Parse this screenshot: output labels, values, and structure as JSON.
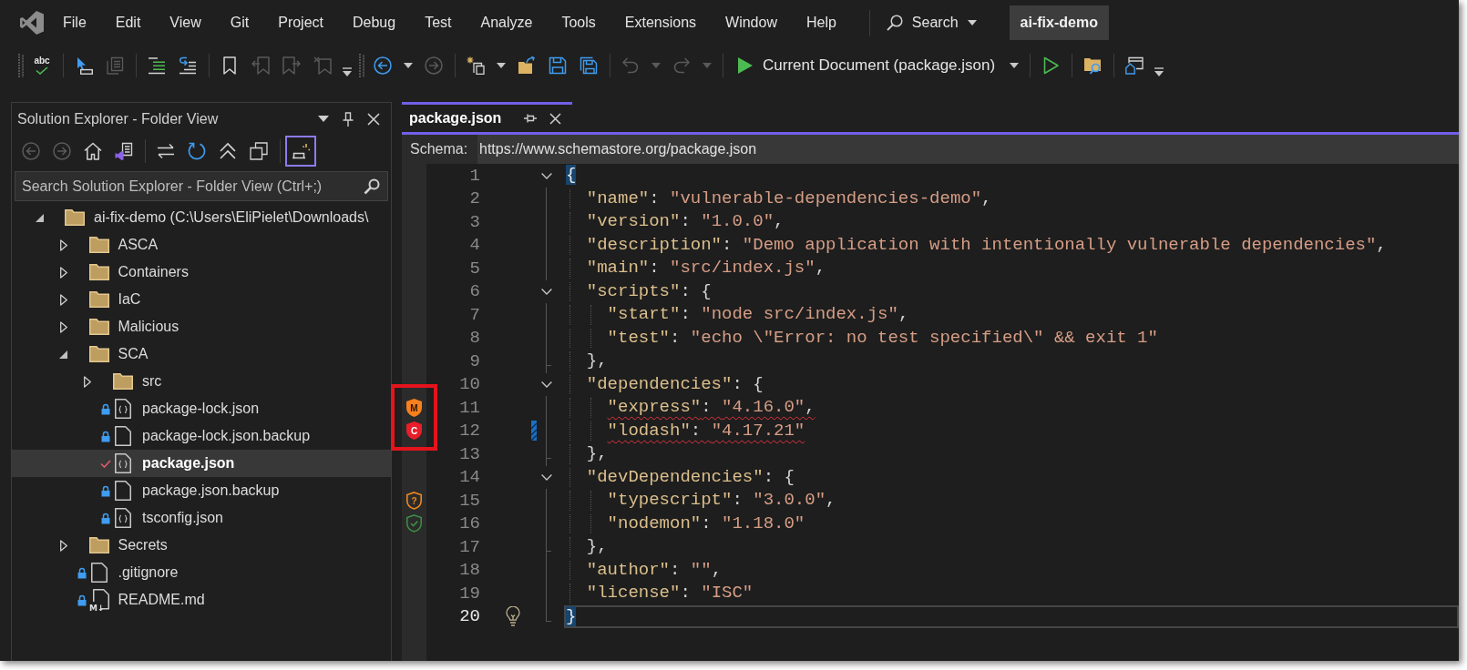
{
  "menu": {
    "items": [
      "File",
      "Edit",
      "View",
      "Git",
      "Project",
      "Debug",
      "Test",
      "Analyze",
      "Tools",
      "Extensions",
      "Window",
      "Help"
    ],
    "search": "Search",
    "solution": "ai-fix-demo"
  },
  "toolbar": {
    "buttons": [
      {
        "kind": "grip"
      },
      {
        "kind": "spell",
        "label": "abc",
        "disabled": false
      },
      {
        "kind": "separator"
      },
      {
        "kind": "select",
        "disabled": false
      },
      {
        "kind": "copy-lines",
        "disabled": true
      },
      {
        "kind": "separator"
      },
      {
        "kind": "comment",
        "disabled": false
      },
      {
        "kind": "uncomment",
        "disabled": false
      },
      {
        "kind": "separator"
      },
      {
        "kind": "bookmark",
        "disabled": false
      },
      {
        "kind": "bookmark-prev",
        "disabled": true
      },
      {
        "kind": "bookmark-next",
        "disabled": true
      },
      {
        "kind": "bookmark-clear",
        "disabled": true
      },
      {
        "kind": "overflow"
      },
      {
        "kind": "grip"
      },
      {
        "kind": "back",
        "disabled": false
      },
      {
        "kind": "caret",
        "disabled": false
      },
      {
        "kind": "forward",
        "disabled": true
      },
      {
        "kind": "separator"
      },
      {
        "kind": "new-item",
        "disabled": false
      },
      {
        "kind": "caret",
        "disabled": false
      },
      {
        "kind": "open",
        "disabled": false
      },
      {
        "kind": "save",
        "disabled": false
      },
      {
        "kind": "save-all",
        "disabled": false
      },
      {
        "kind": "separator"
      },
      {
        "kind": "undo",
        "disabled": true
      },
      {
        "kind": "caret",
        "disabled": true
      },
      {
        "kind": "redo",
        "disabled": true
      },
      {
        "kind": "caret",
        "disabled": true
      },
      {
        "kind": "separator"
      },
      {
        "kind": "run",
        "label": "Current Document (package.json)",
        "disabled": false
      },
      {
        "kind": "caret",
        "disabled": false
      },
      {
        "kind": "separator"
      },
      {
        "kind": "run-outline",
        "disabled": false
      },
      {
        "kind": "separator"
      },
      {
        "kind": "find-folder",
        "disabled": false
      },
      {
        "kind": "separator"
      },
      {
        "kind": "window",
        "disabled": false
      },
      {
        "kind": "overflow"
      }
    ]
  },
  "solution_explorer": {
    "title": "Solution Explorer - Folder View",
    "buttons": [
      {
        "kind": "back",
        "disabled": true,
        "pressed": false
      },
      {
        "kind": "forward",
        "disabled": true,
        "pressed": false
      },
      {
        "kind": "home",
        "disabled": false,
        "pressed": false
      },
      {
        "kind": "switch-views",
        "disabled": false,
        "pressed": false
      },
      {
        "kind": "separator"
      },
      {
        "kind": "sync",
        "disabled": false,
        "pressed": false
      },
      {
        "kind": "refresh",
        "disabled": false,
        "pressed": false
      },
      {
        "kind": "collapse",
        "disabled": false,
        "pressed": false
      },
      {
        "kind": "show-all",
        "disabled": false,
        "pressed": false
      },
      {
        "kind": "separator"
      },
      {
        "kind": "pending",
        "disabled": false,
        "pressed": true
      }
    ],
    "search": {
      "placeholder": "Search Solution Explorer - Folder View (Ctrl+;)"
    },
    "tree": [
      {
        "label": "ai-fix-demo (C:\\Users\\EliPielet\\Downloads\\",
        "kind": "folder",
        "expanded": true,
        "selected": false,
        "children": [
          {
            "label": "ASCA",
            "kind": "folder",
            "expanded": false,
            "selected": false
          },
          {
            "label": "Containers",
            "kind": "folder",
            "expanded": false,
            "selected": false
          },
          {
            "label": "IaC",
            "kind": "folder",
            "expanded": false,
            "selected": false
          },
          {
            "label": "Malicious",
            "kind": "folder",
            "expanded": false,
            "selected": false
          },
          {
            "label": "SCA",
            "kind": "folder",
            "expanded": true,
            "selected": false,
            "children": [
              {
                "label": "src",
                "kind": "folder",
                "expanded": false,
                "selected": false
              },
              {
                "label": "package-lock.json",
                "kind": "json",
                "locked": true,
                "modified": false,
                "selected": false
              },
              {
                "label": "package-lock.json.backup",
                "kind": "file",
                "locked": true,
                "modified": false,
                "selected": false
              },
              {
                "label": "package.json",
                "kind": "json",
                "locked": false,
                "modified": true,
                "selected": true
              },
              {
                "label": "package.json.backup",
                "kind": "file",
                "locked": true,
                "modified": false,
                "selected": false
              },
              {
                "label": "tsconfig.json",
                "kind": "json",
                "locked": true,
                "modified": false,
                "selected": false
              }
            ]
          },
          {
            "label": "Secrets",
            "kind": "folder",
            "expanded": false,
            "selected": false
          },
          {
            "label": ".gitignore",
            "kind": "file",
            "locked": true,
            "modified": false,
            "selected": false
          },
          {
            "label": "README.md",
            "kind": "markdown",
            "icon_text": "M↓",
            "locked": true,
            "modified": false,
            "selected": false
          }
        ]
      }
    ]
  },
  "editor": {
    "tabs": [
      {
        "label": "package.json",
        "selected": true
      }
    ],
    "schema": {
      "label": "Schema:",
      "value": "https://www.schemastore.org/package.json"
    },
    "lines": [
      {
        "number": "1",
        "tokens": [
          {
            "kind": "brace-match",
            "text": "{"
          }
        ],
        "current": false,
        "squiggle": false,
        "expanded": true,
        "children": [
          {
            "number": "2",
            "tokens": [
              {
                "kind": "key",
                "text": "\"name\""
              },
              {
                "kind": "punct",
                "text": ": "
              },
              {
                "kind": "string",
                "text": "\"vulnerable-dependencies-demo\""
              },
              {
                "kind": "punct",
                "text": ","
              }
            ],
            "current": false,
            "squiggle": false
          },
          {
            "number": "3",
            "tokens": [
              {
                "kind": "key",
                "text": "\"version\""
              },
              {
                "kind": "punct",
                "text": ": "
              },
              {
                "kind": "string",
                "text": "\"1.0.0\""
              },
              {
                "kind": "punct",
                "text": ","
              }
            ],
            "current": false,
            "squiggle": false
          },
          {
            "number": "4",
            "tokens": [
              {
                "kind": "key",
                "text": "\"description\""
              },
              {
                "kind": "punct",
                "text": ": "
              },
              {
                "kind": "string",
                "text": "\"Demo application with intentionally vulnerable dependencies\""
              },
              {
                "kind": "punct",
                "text": ","
              }
            ],
            "current": false,
            "squiggle": false
          },
          {
            "number": "5",
            "tokens": [
              {
                "kind": "key",
                "text": "\"main\""
              },
              {
                "kind": "punct",
                "text": ": "
              },
              {
                "kind": "string",
                "text": "\"src/index.js\""
              },
              {
                "kind": "punct",
                "text": ","
              }
            ],
            "current": false,
            "squiggle": false
          },
          {
            "number": "6",
            "tokens": [
              {
                "kind": "key",
                "text": "\"scripts\""
              },
              {
                "kind": "punct",
                "text": ": {"
              }
            ],
            "current": false,
            "squiggle": false,
            "expanded": true,
            "children": [
              {
                "number": "7",
                "tokens": [
                  {
                    "kind": "key",
                    "text": "\"start\""
                  },
                  {
                    "kind": "punct",
                    "text": ": "
                  },
                  {
                    "kind": "string",
                    "text": "\"node src/index.js\""
                  },
                  {
                    "kind": "punct",
                    "text": ","
                  }
                ],
                "current": false,
                "squiggle": false
              },
              {
                "number": "8",
                "tokens": [
                  {
                    "kind": "key",
                    "text": "\"test\""
                  },
                  {
                    "kind": "punct",
                    "text": ": "
                  },
                  {
                    "kind": "string",
                    "text": "\"echo \\\"Error: no test specified\\\" && exit 1\""
                  }
                ],
                "current": false,
                "squiggle": false
              }
            ]
          },
          {
            "number": "9",
            "tokens": [
              {
                "kind": "punct",
                "text": "},"
              }
            ],
            "current": false,
            "squiggle": false
          },
          {
            "number": "10",
            "tokens": [
              {
                "kind": "key",
                "text": "\"dependencies\""
              },
              {
                "kind": "punct",
                "text": ": {"
              }
            ],
            "current": false,
            "squiggle": false,
            "expanded": true,
            "children": [
              {
                "number": "11",
                "tokens": [
                  {
                    "kind": "key",
                    "text": "\"express\""
                  },
                  {
                    "kind": "punct",
                    "text": ": "
                  },
                  {
                    "kind": "string",
                    "text": "\"4.16.0\""
                  },
                  {
                    "kind": "punct",
                    "text": ","
                  }
                ],
                "current": false,
                "squiggle": true,
                "gutter": {
                  "kind": "shield",
                  "label": "M",
                  "color": "#f7801e"
                }
              },
              {
                "number": "12",
                "tokens": [
                  {
                    "kind": "key",
                    "text": "\"lodash\""
                  },
                  {
                    "kind": "punct",
                    "text": ": "
                  },
                  {
                    "kind": "string",
                    "text": "\"4.17.21\""
                  }
                ],
                "current": false,
                "squiggle": true,
                "gutter": {
                  "kind": "shield",
                  "label": "C",
                  "color": "#e81e2a"
                },
                "glyph": {
                  "kind": "change"
                }
              }
            ]
          },
          {
            "number": "13",
            "tokens": [
              {
                "kind": "punct",
                "text": "},"
              }
            ],
            "current": false,
            "squiggle": false
          },
          {
            "number": "14",
            "tokens": [
              {
                "kind": "key",
                "text": "\"devDependencies\""
              },
              {
                "kind": "punct",
                "text": ": {"
              }
            ],
            "current": false,
            "squiggle": false,
            "expanded": true,
            "children": [
              {
                "number": "15",
                "tokens": [
                  {
                    "kind": "key",
                    "text": "\"typescript\""
                  },
                  {
                    "kind": "punct",
                    "text": ": "
                  },
                  {
                    "kind": "string",
                    "text": "\"3.0.0\""
                  },
                  {
                    "kind": "punct",
                    "text": ","
                  }
                ],
                "current": false,
                "squiggle": false,
                "gutter": {
                  "kind": "shield-outline",
                  "label": "?",
                  "color": "#f08a1c"
                }
              },
              {
                "number": "16",
                "tokens": [
                  {
                    "kind": "key",
                    "text": "\"nodemon\""
                  },
                  {
                    "kind": "punct",
                    "text": ": "
                  },
                  {
                    "kind": "string",
                    "text": "\"1.18.0\""
                  }
                ],
                "current": false,
                "squiggle": false,
                "gutter": {
                  "kind": "shield-check",
                  "color": "#3c8c45"
                }
              }
            ]
          },
          {
            "number": "17",
            "tokens": [
              {
                "kind": "punct",
                "text": "},"
              }
            ],
            "current": false,
            "squiggle": false
          },
          {
            "number": "18",
            "tokens": [
              {
                "kind": "key",
                "text": "\"author\""
              },
              {
                "kind": "punct",
                "text": ": "
              },
              {
                "kind": "string",
                "text": "\"\""
              },
              {
                "kind": "punct",
                "text": ","
              }
            ],
            "current": false,
            "squiggle": false
          },
          {
            "number": "19",
            "tokens": [
              {
                "kind": "key",
                "text": "\"license\""
              },
              {
                "kind": "punct",
                "text": ": "
              },
              {
                "kind": "string",
                "text": "\"ISC\""
              }
            ],
            "current": false,
            "squiggle": false
          }
        ]
      },
      {
        "number": "20",
        "tokens": [
          {
            "kind": "brace-match",
            "text": "}"
          }
        ],
        "current": true,
        "squiggle": false,
        "glyph": {
          "kind": "lightbulb"
        }
      }
    ]
  }
}
